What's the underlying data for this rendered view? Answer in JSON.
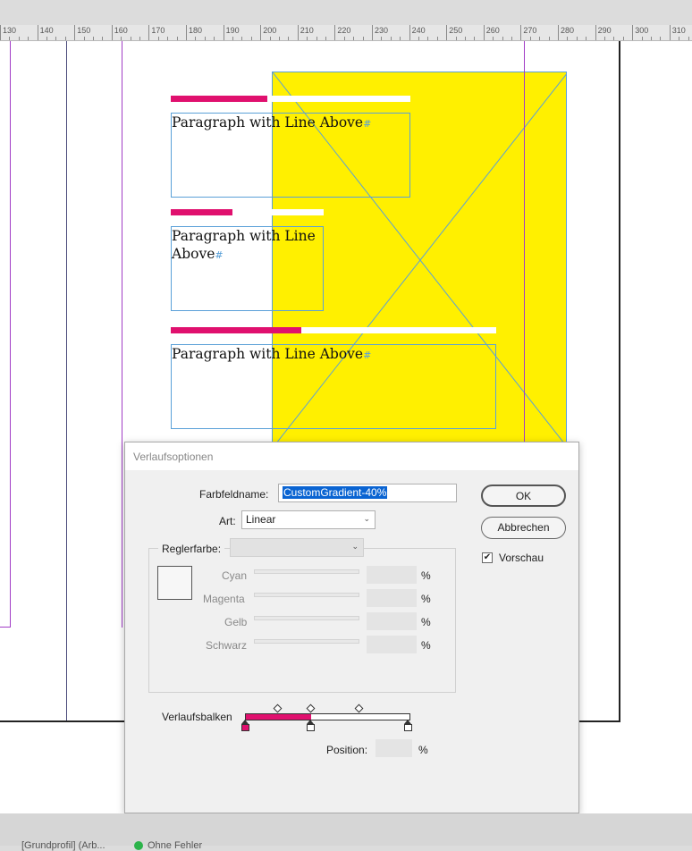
{
  "ruler": {
    "ticks": [
      "130",
      "140",
      "150",
      "160",
      "170",
      "180",
      "190",
      "200",
      "210",
      "220",
      "230",
      "240",
      "250",
      "260",
      "270",
      "280",
      "290",
      "300",
      "310"
    ]
  },
  "document": {
    "paragraphs": [
      {
        "text": "Paragraph with Line Above"
      },
      {
        "text_line1": "Paragraph with Line",
        "text_line2": "Above"
      },
      {
        "text": "Paragraph with Line Above"
      }
    ],
    "pilcrow": "#",
    "colors": {
      "accent": "#e0106e",
      "fill": "#fff000",
      "frame": "#5aa0d8",
      "guide": "#a13dc6"
    }
  },
  "dialog": {
    "title": "Verlaufsoptionen",
    "swatch_name_label": "Farbfeldname:",
    "swatch_name_value": "CustomGradient-40%",
    "type_label": "Art:",
    "type_value": "Linear",
    "stop_color_label": "Reglerfarbe:",
    "stop_color_value": "",
    "channels": [
      {
        "label": "Cyan",
        "unit": "%"
      },
      {
        "label": "Magenta",
        "unit": "%"
      },
      {
        "label": "Gelb",
        "unit": "%"
      },
      {
        "label": "Schwarz",
        "unit": "%"
      }
    ],
    "gradient_ramp_label": "Verlaufsbalken",
    "position_label": "Position:",
    "position_unit": "%",
    "ok_label": "OK",
    "cancel_label": "Abbrechen",
    "preview_label": "Vorschau",
    "preview_checked": true,
    "gradient_fill_fraction": 0.4
  },
  "statusbar": {
    "profile": "[Grundprofil] (Arb...",
    "preflight": "Ohne Fehler"
  }
}
